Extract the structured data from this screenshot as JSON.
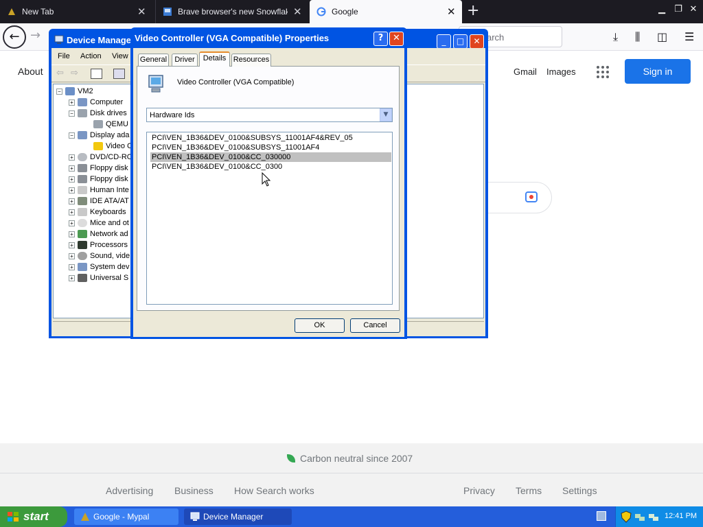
{
  "browser": {
    "tabs": [
      {
        "label": "New Tab"
      },
      {
        "label": "Brave browser's new Snowflake fe"
      },
      {
        "label": "Google"
      }
    ],
    "url_placeholder": "arch"
  },
  "google": {
    "about": "About",
    "gmail": "Gmail",
    "images": "Images",
    "signin": "Sign in",
    "carbon": "Carbon neutral since 2007",
    "footer_left": [
      "Advertising",
      "Business",
      "How Search works"
    ],
    "footer_right": [
      "Privacy",
      "Terms",
      "Settings"
    ]
  },
  "device_manager": {
    "title": "Device Manager",
    "menu": [
      "File",
      "Action",
      "View"
    ],
    "tree": [
      {
        "label": "VM2"
      },
      {
        "label": "Computer"
      },
      {
        "label": "Disk drives"
      },
      {
        "label": "QEMU H"
      },
      {
        "label": "Display ada"
      },
      {
        "label": "Video C"
      },
      {
        "label": "DVD/CD-RO"
      },
      {
        "label": "Floppy disk"
      },
      {
        "label": "Floppy disk"
      },
      {
        "label": "Human Inte"
      },
      {
        "label": "IDE ATA/AT"
      },
      {
        "label": "Keyboards"
      },
      {
        "label": "Mice and ot"
      },
      {
        "label": "Network ad"
      },
      {
        "label": "Processors"
      },
      {
        "label": "Sound, vide"
      },
      {
        "label": "System dev"
      },
      {
        "label": "Universal S"
      }
    ]
  },
  "properties": {
    "title": "Video Controller (VGA Compatible) Properties",
    "tabs": [
      "General",
      "Driver",
      "Details",
      "Resources"
    ],
    "device_name": "Video Controller (VGA Compatible)",
    "property_selected": "Hardware Ids",
    "values": [
      "PCI\\VEN_1B36&DEV_0100&SUBSYS_11001AF4&REV_05",
      "PCI\\VEN_1B36&DEV_0100&SUBSYS_11001AF4",
      "PCI\\VEN_1B36&DEV_0100&CC_030000",
      "PCI\\VEN_1B36&DEV_0100&CC_0300"
    ],
    "ok": "OK",
    "cancel": "Cancel"
  },
  "taskbar": {
    "start": "start",
    "items": [
      "Google - Mypal",
      "Device Manager"
    ],
    "clock": "12:41 PM"
  },
  "colors": {
    "xp_title_blue": "#0054e3",
    "google_blue": "#1a73e8",
    "taskbar_blue": "#245edb",
    "start_green": "#3c9a3c"
  }
}
